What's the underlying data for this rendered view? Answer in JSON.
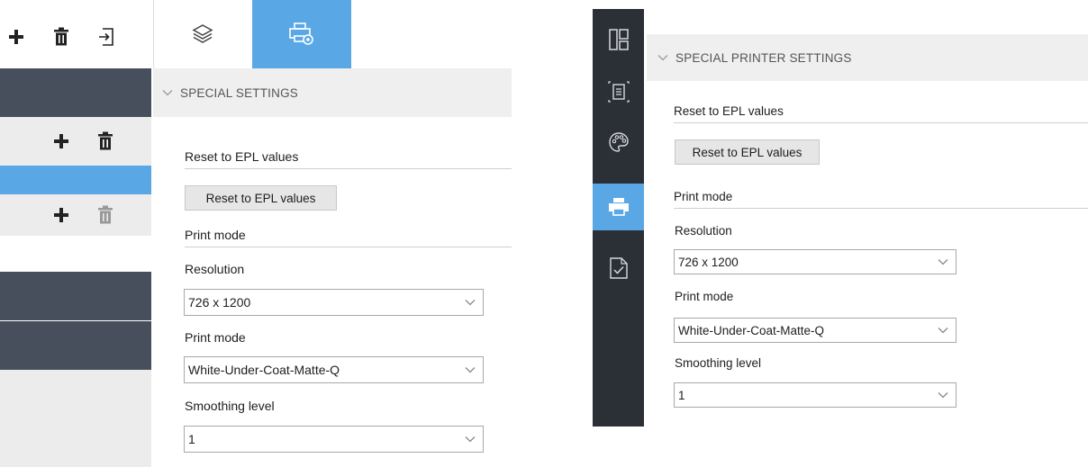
{
  "left": {
    "sidebar": {
      "toolbar_icons": [
        "plus-icon",
        "trash-icon",
        "import-icon"
      ],
      "row1_icons": [
        "plus-icon",
        "trash-icon"
      ],
      "row2_icons": [
        "plus-icon",
        "trash-icon"
      ]
    },
    "tabs": [
      {
        "icon": "layers-icon",
        "active": false
      },
      {
        "icon": "printer-settings-icon",
        "active": true
      }
    ],
    "section_title": "SPECIAL SETTINGS",
    "reset_group_label": "Reset to EPL values",
    "reset_button_label": "Reset to EPL values",
    "print_mode_group_label": "Print mode",
    "resolution_label": "Resolution",
    "resolution_value": "726 x 1200",
    "print_mode_label": "Print mode",
    "print_mode_value": "White-Under-Coat-Matte-Q",
    "smoothing_label": "Smoothing level",
    "smoothing_value": "1"
  },
  "right": {
    "nav_icons": [
      "layout-icon",
      "chip-icon",
      "palette-icon",
      "printer-icon",
      "checklist-icon"
    ],
    "active_nav": "printer-icon",
    "section_title": "SPECIAL PRINTER SETTINGS",
    "reset_group_label": "Reset to EPL values",
    "reset_button_label": "Reset to EPL values",
    "print_mode_group_label": "Print mode",
    "resolution_label": "Resolution",
    "resolution_value": "726 x 1200",
    "print_mode_label": "Print mode",
    "print_mode_value": "White-Under-Coat-Matte-Q",
    "smoothing_label": "Smoothing level",
    "smoothing_value": "1"
  },
  "colors": {
    "accent": "#5aa7e6",
    "dark_sidebar": "#474f5c",
    "nav_bg": "#2b2f36",
    "header_bg": "#efefef"
  }
}
